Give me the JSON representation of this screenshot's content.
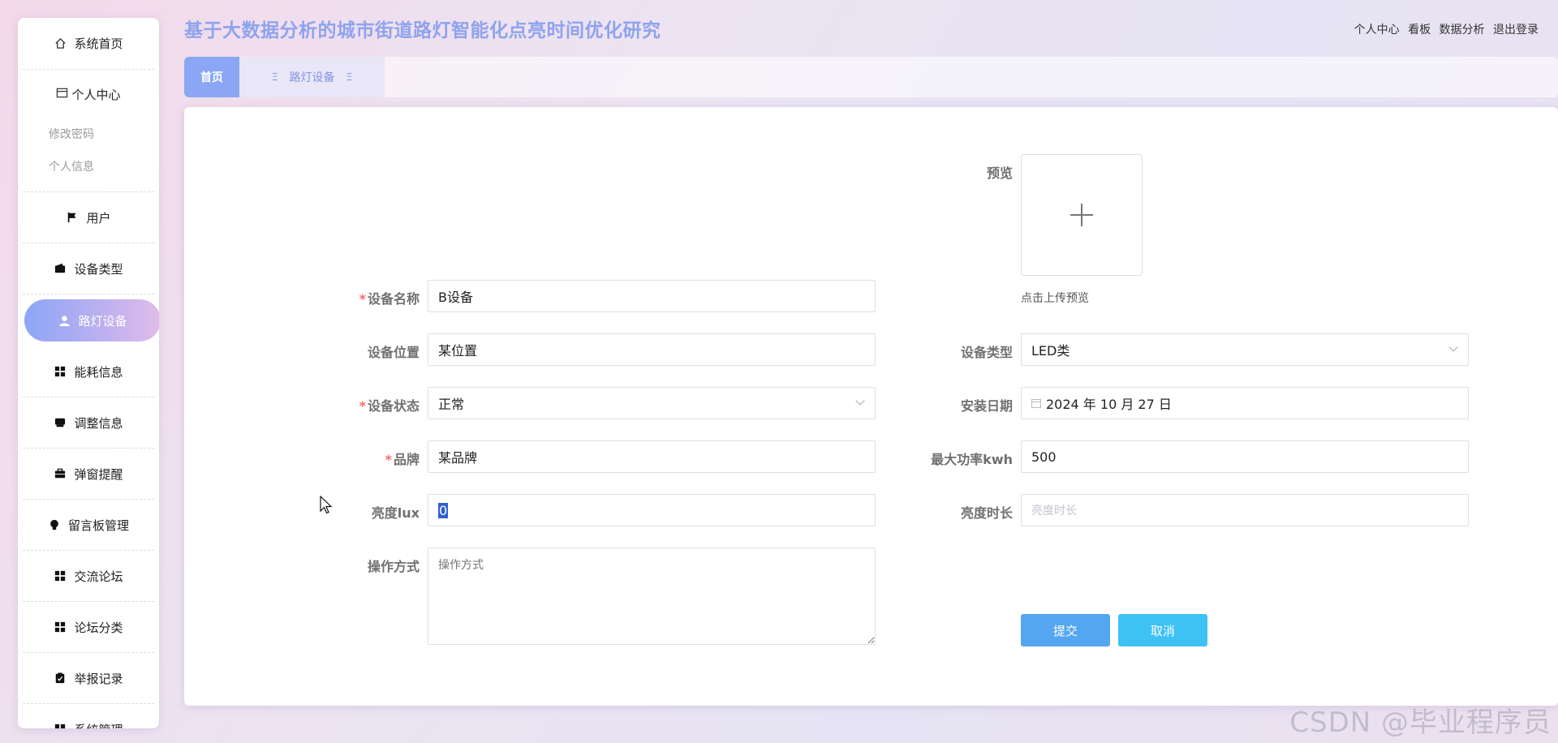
{
  "app": {
    "title": "基于大数据分析的城市街道路灯智能化点亮时间优化研究",
    "top_links": [
      "个人中心",
      "看板",
      "数据分析",
      "退出登录"
    ]
  },
  "sidebar": {
    "home": "系统首页",
    "personal": {
      "label": "个人中心",
      "subs": [
        "修改密码",
        "个人信息"
      ]
    },
    "items": [
      {
        "label": "用户",
        "icon": "flag-icon"
      },
      {
        "label": "设备类型",
        "icon": "wallet-icon"
      },
      {
        "label": "路灯设备",
        "icon": "user-icon",
        "active": true
      },
      {
        "label": "能耗信息",
        "icon": "grid-icon"
      },
      {
        "label": "调整信息",
        "icon": "printer-icon"
      },
      {
        "label": "弹窗提醒",
        "icon": "briefcase-icon"
      },
      {
        "label": "留言板管理",
        "icon": "bulb-icon"
      },
      {
        "label": "交流论坛",
        "icon": "grid-icon"
      },
      {
        "label": "论坛分类",
        "icon": "grid-icon"
      },
      {
        "label": "举报记录",
        "icon": "clipboard-icon"
      },
      {
        "label": "系统管理",
        "icon": "grid-icon"
      }
    ]
  },
  "tabs": {
    "home": "首页",
    "device": "路灯设备",
    "mark": "Ξ"
  },
  "form": {
    "preview_label": "预览",
    "upload_tip": "点击上传预览",
    "device_name": {
      "label": "设备名称",
      "value": "B设备",
      "required": "*"
    },
    "location": {
      "label": "设备位置",
      "value": "某位置"
    },
    "device_type": {
      "label": "设备类型",
      "value": "LED类"
    },
    "status": {
      "label": "设备状态",
      "value": "正常",
      "required": "*"
    },
    "install_date": {
      "label": "安装日期",
      "value": "2024 年 10 月 27 日"
    },
    "brand": {
      "label": "品牌",
      "value": "某品牌",
      "required": "*"
    },
    "max_power": {
      "label": "最大功率kwh",
      "value": "500"
    },
    "brightness": {
      "label": "亮度lux",
      "value": "0"
    },
    "duration": {
      "label": "亮度时长",
      "placeholder": "亮度时长"
    },
    "operation": {
      "label": "操作方式",
      "placeholder": "操作方式"
    },
    "submit": "提交",
    "cancel": "取消"
  },
  "watermark": "CSDN @毕业程序员",
  "colors": {
    "accent": "#8da5f7",
    "submit": "#55a6f0",
    "cancel": "#3ec2f5",
    "title": "#8ea3ee",
    "required": "#f56c6c"
  }
}
